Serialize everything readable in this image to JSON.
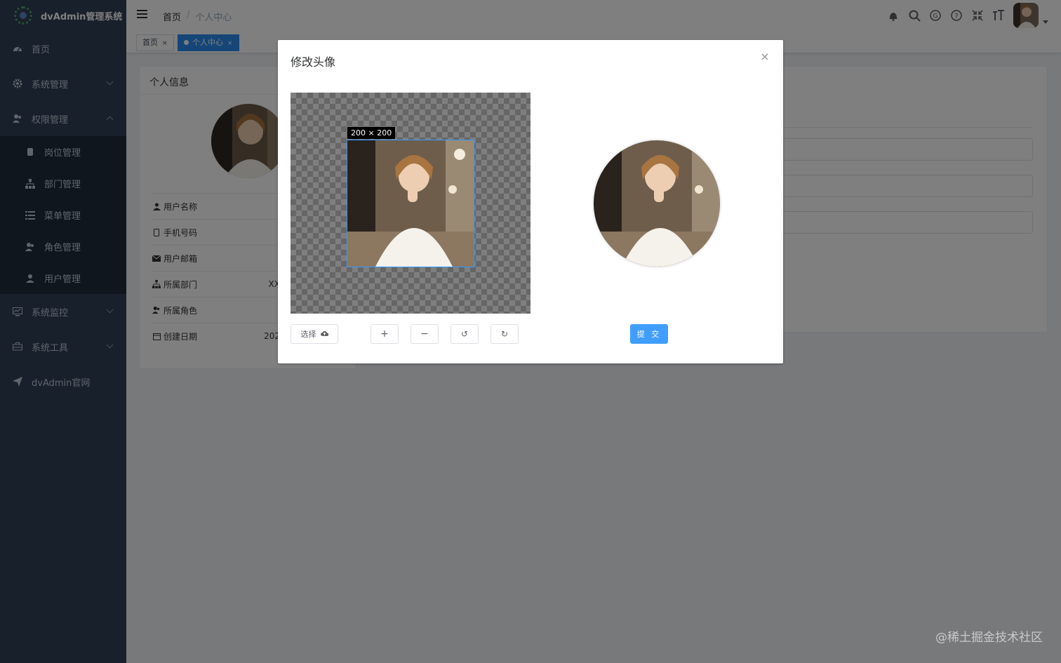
{
  "app": {
    "title": "dvAdmin管理系统"
  },
  "sidebar": {
    "items": [
      {
        "label": "首页",
        "icon": "dashboard-icon"
      },
      {
        "label": "系统管理",
        "icon": "gear-icon"
      },
      {
        "label": "权限管理",
        "icon": "users-icon",
        "expanded": true
      },
      {
        "label": "系统监控",
        "icon": "monitor-icon"
      },
      {
        "label": "系统工具",
        "icon": "toolbox-icon"
      },
      {
        "label": "dvAdmin官网",
        "icon": "send-icon"
      }
    ],
    "submenu": [
      {
        "label": "岗位管理",
        "icon": "badge-icon"
      },
      {
        "label": "部门管理",
        "icon": "sitemap-icon"
      },
      {
        "label": "菜单管理",
        "icon": "list-icon"
      },
      {
        "label": "角色管理",
        "icon": "users-icon"
      },
      {
        "label": "用户管理",
        "icon": "user-icon"
      }
    ]
  },
  "header": {
    "breadcrumb_home": "首页",
    "breadcrumb_sep": "/",
    "breadcrumb_current": "个人中心"
  },
  "tags": [
    {
      "label": "首页",
      "close": "×"
    },
    {
      "label": "个人中心",
      "close": "×",
      "active": true
    }
  ],
  "profile": {
    "card_title": "个人信息",
    "rows": [
      {
        "label": "用户名称",
        "value": ""
      },
      {
        "label": "手机号码",
        "value": ""
      },
      {
        "label": "用户邮箱",
        "value": ""
      },
      {
        "label": "所属部门",
        "value": "XX"
      },
      {
        "label": "所属角色",
        "value": ""
      },
      {
        "label": "创建日期",
        "value": "202"
      }
    ]
  },
  "dialog": {
    "title": "修改头像",
    "close": "×",
    "crop_size": "200 × 200",
    "select_label": "选择",
    "zoom_in": "+",
    "zoom_out": "−",
    "rotate_left": "↺",
    "rotate_right": "↻",
    "submit_label": "提 交"
  },
  "watermark": "@稀土掘金技术社区",
  "colors": {
    "sidebar_bg": "#304156",
    "submenu_bg": "#1f2d3d",
    "primary": "#409eff",
    "active_tag": "#2d8cf0"
  }
}
